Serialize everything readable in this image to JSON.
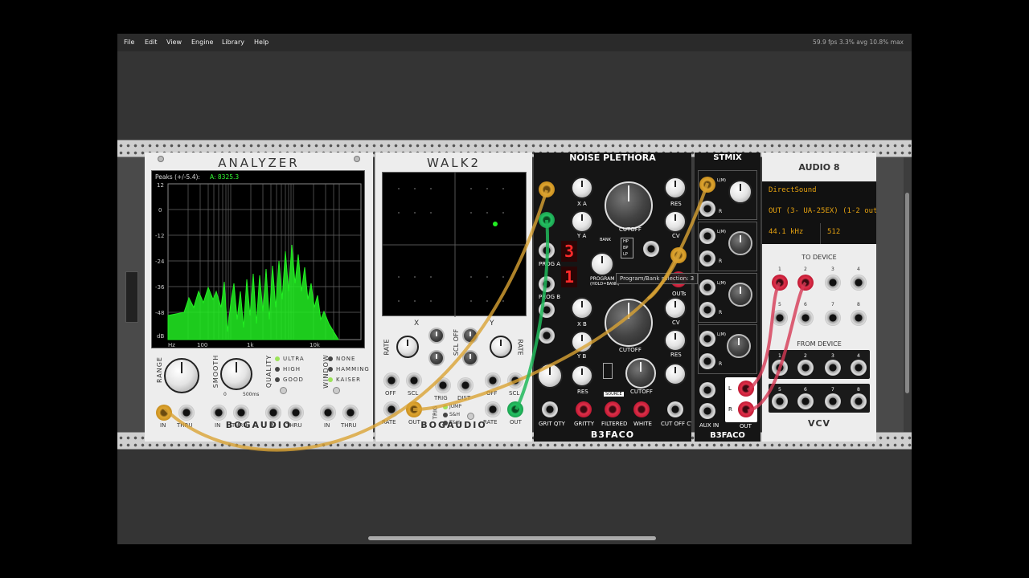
{
  "menu": {
    "file": "File",
    "edit": "Edit",
    "view": "View",
    "engine": "Engine",
    "library": "Library",
    "help": "Help"
  },
  "perf": "59.9 fps  3.3% avg  10.8% max",
  "analyzer": {
    "title": "ANALYZER",
    "readout": "Peaks (+/-5.4):",
    "readout_value": "A: 8325.3",
    "y_ticks": [
      "12",
      "0",
      "-12",
      "-24",
      "-36",
      "-48",
      "dB"
    ],
    "x_ticks": [
      "Hz",
      "100",
      "1k",
      "10k"
    ],
    "range": "RANGE",
    "smooth": "SMOOTH",
    "smooth_min": "0",
    "smooth_max": "500ms",
    "quality": "QUALITY",
    "quality_opts": [
      "ULTRA",
      "HIGH",
      "GOOD"
    ],
    "window": "WINDOW",
    "window_opts": [
      "NONE",
      "HAMMING",
      "KAISER"
    ],
    "in": "IN",
    "thru": "THRU",
    "brand": "BOGAUDIO"
  },
  "walk2": {
    "title": "WALK2",
    "x": "X",
    "y": "Y",
    "rate": "RATE",
    "scl": "SCL",
    "off": "OFF",
    "trig": "TRIG",
    "dist": "DIST",
    "jump": "JUMP",
    "sh": "S&H",
    "th": "T&H",
    "out": "OUT",
    "brand": "BOGAUDIO"
  },
  "noise": {
    "title": "NOISE PLETHORA",
    "xa": "X A",
    "ya": "Y A",
    "xb": "X B",
    "yb": "Y B",
    "cutoff": "CUTOFF",
    "res": "RES",
    "cv": "CV",
    "prog_a": "PROG A",
    "prog_b": "PROG B",
    "program": "PROGRAM",
    "hold_bank": "(HOLD=BANK)",
    "bank": "BANK",
    "hp": "HP",
    "bp": "BP",
    "lp": "LP",
    "outs": "OUTs",
    "seg_a": "3",
    "seg_b": "1",
    "grit_qty": "GRIT QTY",
    "gritty": "GRITTY",
    "source": "SOURCE",
    "filtered": "FILTERED",
    "white": "WHITE",
    "cut_off_cv": "CUT OFF CV",
    "brand": "B3FACO"
  },
  "tooltip": "Program/Bank selection: 3",
  "stmix": {
    "title": "STMIX",
    "l": "L(M)",
    "r": "R",
    "aux_in": "AUX IN",
    "out": "OUT",
    "out_l": "L",
    "out_r": "R",
    "brand": "B3FACO"
  },
  "audio8": {
    "title": "AUDIO 8",
    "driver": "DirectSound",
    "device": "OUT (3- UA-25EX) (1-2 out",
    "rate": "44.1 kHz",
    "block": "512",
    "to_device": "TO DEVICE",
    "from_device": "FROM DEVICE",
    "nums": [
      "1",
      "2",
      "3",
      "4",
      "5",
      "6",
      "7",
      "8"
    ],
    "brand": "VCV"
  },
  "colors": {
    "cable_gold": "#d9a233",
    "cable_green": "#20b85a",
    "cable_red": "#d63a55",
    "spectrum": "#22ee22"
  }
}
